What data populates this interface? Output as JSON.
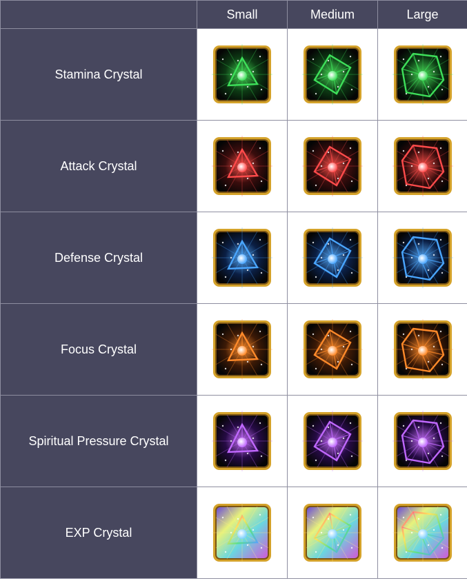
{
  "columns": [
    "Small",
    "Medium",
    "Large"
  ],
  "rows": [
    {
      "label": "Stamina Crystal",
      "color": "#3ee05a",
      "bg": "#0d3a14"
    },
    {
      "label": "Attack Crystal",
      "color": "#ff4b4b",
      "bg": "#3a0d0d"
    },
    {
      "label": "Defense Crystal",
      "color": "#4aa6ff",
      "bg": "#0b1f45"
    },
    {
      "label": "Focus Crystal",
      "color": "#ff8a2a",
      "bg": "#3d1a06"
    },
    {
      "label": "Spiritual Pressure Crystal",
      "color": "#c068ff",
      "bg": "#260b45"
    },
    {
      "label": "EXP Crystal",
      "color": "rainbow",
      "bg": "#2a2a48"
    }
  ],
  "icons": {
    "sizes": [
      "small",
      "medium",
      "large"
    ],
    "frame_color": "#d4a22a"
  }
}
